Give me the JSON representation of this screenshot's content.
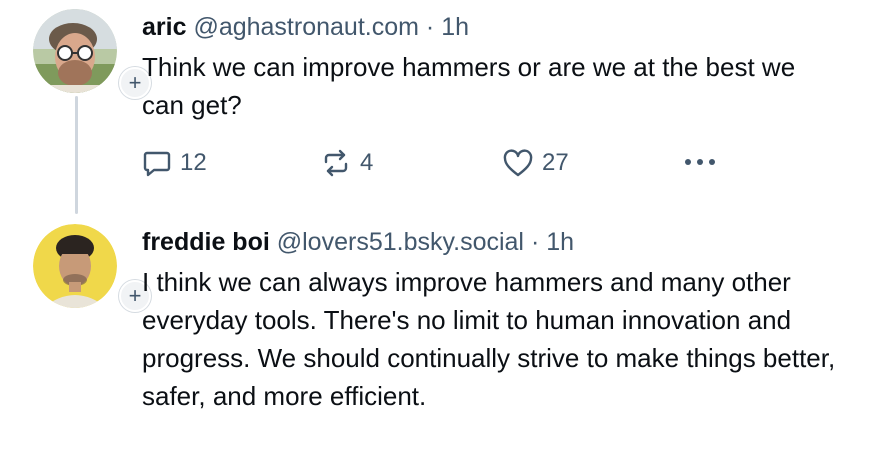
{
  "post1": {
    "display_name": "aric",
    "handle": "@aghastronaut.com",
    "separator": "·",
    "time": "1h",
    "text": "Think we can improve hammers or are we at the best we can get?",
    "follow_symbol": "+",
    "actions": {
      "reply_count": "12",
      "repost_count": "4",
      "like_count": "27",
      "more_icon": "more-horizontal-icon"
    }
  },
  "post2": {
    "display_name": "freddie boi",
    "handle": "@lovers51.bsky.social",
    "separator": "·",
    "time": "1h",
    "text": "I think we can always improve hammers and many other everyday tools. There's no limit to human innovation and progress. We should continually strive to make things better, safer, and more efficient.",
    "follow_symbol": "+"
  },
  "colors": {
    "text_primary": "#0b0f14",
    "text_secondary": "#42576c",
    "thread_line": "#cfd6de",
    "avatar2_bg": "#f0d84a"
  }
}
